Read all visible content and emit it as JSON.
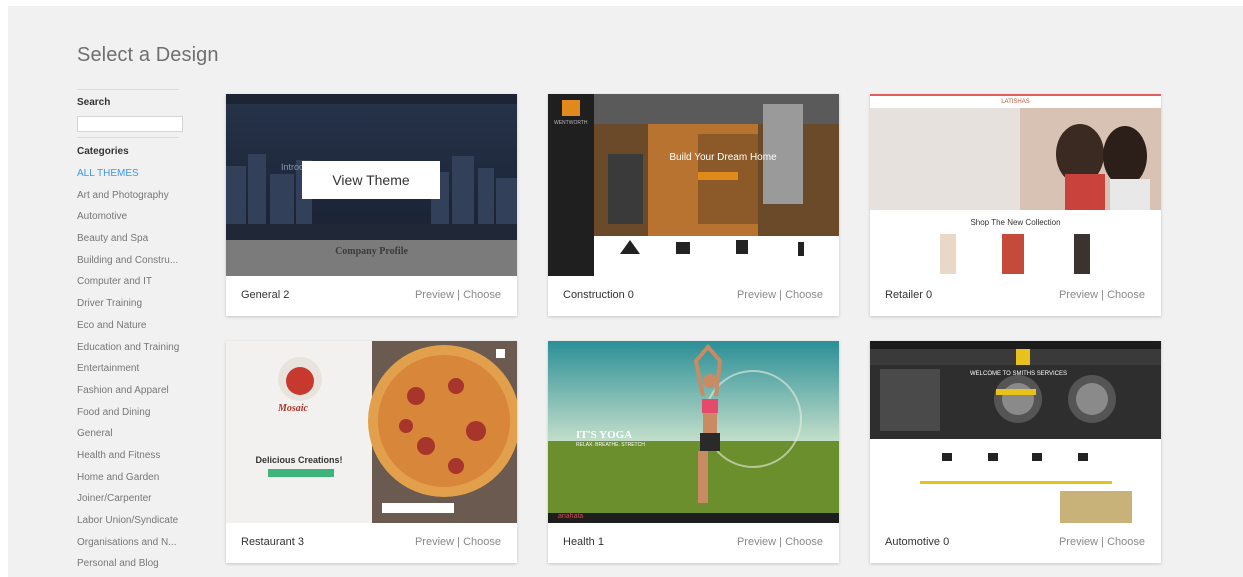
{
  "page": {
    "title": "Select a Design"
  },
  "sidebar": {
    "search_label": "Search",
    "search_value": "",
    "categories_label": "Categories",
    "categories": [
      "ALL THEMES",
      "Art and Photography",
      "Automotive",
      "Beauty and Spa",
      "Building and Constru...",
      "Computer and IT",
      "Driver Training",
      "Eco and Nature",
      "Education and Training",
      "Entertainment",
      "Fashion and Apparel",
      "Food and Dining",
      "General",
      "Health and Fitness",
      "Home and Garden",
      "Joiner/Carpenter",
      "Labor Union/Syndicate",
      "Organisations and N...",
      "Personal and Blog"
    ],
    "active_category": "ALL THEMES"
  },
  "themes": [
    {
      "name": "General 2",
      "preview": "Preview",
      "separator": "|",
      "choose": "Choose",
      "hover_label": "View Theme",
      "thumb_text": {
        "headline": "Introd...ent.",
        "section": "Company Profile"
      }
    },
    {
      "name": "Construction 0",
      "preview": "Preview",
      "separator": "|",
      "choose": "Choose",
      "thumb_text": {
        "brand": "WENTWORTH",
        "headline": "Build Your Dream Home"
      }
    },
    {
      "name": "Retailer 0",
      "preview": "Preview",
      "separator": "|",
      "choose": "Choose",
      "thumb_text": {
        "brand": "LATISHAS",
        "headline": "Shop The New Collection"
      }
    },
    {
      "name": "Restaurant 3",
      "preview": "Preview",
      "separator": "|",
      "choose": "Choose",
      "thumb_text": {
        "brand": "Mosaic",
        "headline": "Delicious Creations!"
      }
    },
    {
      "name": "Health 1",
      "preview": "Preview",
      "separator": "|",
      "choose": "Choose",
      "thumb_text": {
        "headline": "IT'S YOGA",
        "sub": "RELAX. BREATHE. STRETCH",
        "brand": "anahata"
      }
    },
    {
      "name": "Automotive 0",
      "preview": "Preview",
      "separator": "|",
      "choose": "Choose",
      "thumb_text": {
        "headline": "WELCOME TO SMITHS SERVICES"
      }
    }
  ],
  "colors": {
    "accent": "#3d97e8",
    "background": "#f1f1f1"
  }
}
